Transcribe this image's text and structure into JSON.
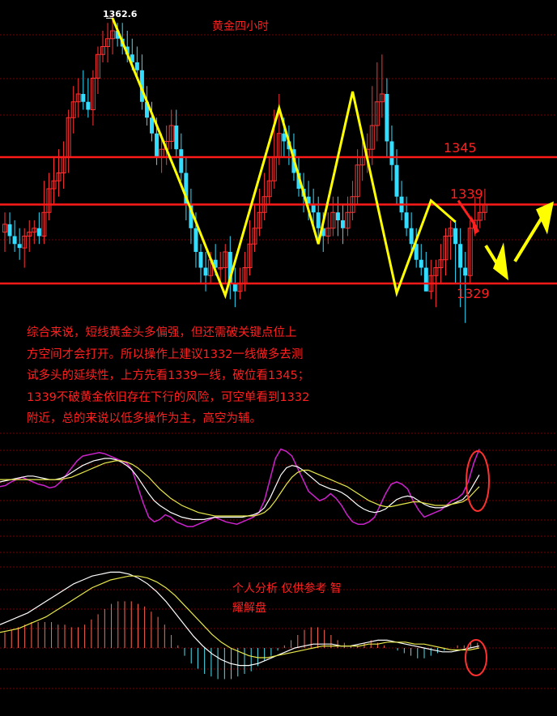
{
  "title": "黄金四小时",
  "peak_label": "1362.6",
  "levels": [
    {
      "value": 1345,
      "label": "1345"
    },
    {
      "value": 1339,
      "label": "1339"
    },
    {
      "value": 1329,
      "label": "1329"
    }
  ],
  "analysis_lines": [
    "综合来说，短线黄金头多偏强，但还需破关键点位上",
    "方空间才会打开。所以操作上建议1332一线做多去测",
    "试多头的延续性，上方先看1339一线，破位看1345；",
    "1339不破黄金依旧存在下行的风险，可空单看到1332",
    "附近，总的来说以低多操作为主，高空为辅。"
  ],
  "disclaimer_line1": "个人分析 仅供参考  智",
  "disclaimer_line2": "耀解盘",
  "colors": {
    "background": "#000000",
    "level_line": "#ff1a1a",
    "grid": "#7a0000",
    "bull_candle": "#ff3333",
    "bear_candle": "#33ddff",
    "zigzag": "#ffff00",
    "annotation_text": "#ff2020",
    "indicator_magenta": "#cc22cc",
    "indicator_white": "#ffffff",
    "indicator_yellow": "#e8e84a"
  },
  "chart_data": {
    "type": "candlestick",
    "ylim": [
      1325,
      1364
    ],
    "x": [
      1,
      2,
      3,
      4,
      5,
      6,
      7,
      8,
      9,
      10,
      11,
      12,
      13,
      14,
      15,
      16,
      17,
      18,
      19,
      20,
      21,
      22,
      23,
      24,
      25,
      26,
      27,
      28,
      29,
      30,
      31,
      32,
      33,
      34,
      35,
      36,
      37,
      38,
      39,
      40,
      41,
      42,
      43,
      44,
      45,
      46,
      47,
      48,
      49,
      50,
      51,
      52,
      53,
      54,
      55,
      56,
      57,
      58,
      59,
      60,
      61,
      62,
      63,
      64,
      65,
      66,
      67,
      68,
      69,
      70,
      71,
      72,
      73,
      74,
      75,
      76,
      77,
      78,
      79,
      80,
      81,
      82,
      83,
      84,
      85,
      86,
      87,
      88,
      89,
      90,
      91,
      92,
      93,
      94,
      95,
      96,
      97,
      98,
      99,
      100
    ],
    "open": [
      1335.5,
      1336.5,
      1335,
      1334,
      1333.5,
      1335,
      1335.5,
      1336,
      1335,
      1338,
      1341,
      1342,
      1343,
      1345,
      1350,
      1352,
      1353,
      1352,
      1351,
      1355,
      1358,
      1359,
      1360,
      1361,
      1360,
      1359,
      1358,
      1357,
      1356,
      1352,
      1350,
      1348,
      1345,
      1346,
      1347,
      1349,
      1346,
      1343,
      1339,
      1336,
      1333,
      1331,
      1330,
      1332,
      1331,
      1331,
      1333,
      1329,
      1328,
      1329,
      1331,
      1334,
      1336,
      1338,
      1340,
      1342,
      1345,
      1348,
      1347,
      1346,
      1343,
      1341,
      1340,
      1339,
      1338,
      1336,
      1335,
      1336,
      1338,
      1337,
      1336,
      1338,
      1340,
      1344,
      1345,
      1346,
      1349,
      1352,
      1353,
      1347,
      1344,
      1340,
      1338,
      1336,
      1334,
      1332,
      1331,
      1328,
      1330,
      1331,
      1332,
      1335,
      1336,
      1334,
      1331,
      1330,
      1336,
      1337,
      1338,
      1339
    ],
    "high": [
      1338,
      1338,
      1337,
      1336,
      1336,
      1337,
      1337,
      1338,
      1342,
      1343,
      1345,
      1346,
      1347,
      1351,
      1354,
      1355,
      1356,
      1355,
      1356,
      1359,
      1361,
      1362,
      1363,
      1362,
      1362,
      1361,
      1360,
      1359,
      1358,
      1354,
      1352,
      1350,
      1348,
      1349,
      1351,
      1351,
      1348,
      1345,
      1341,
      1338,
      1334,
      1333,
      1333,
      1334,
      1333,
      1334,
      1335,
      1331,
      1331,
      1333,
      1337,
      1339,
      1341,
      1343,
      1345,
      1351,
      1353,
      1350,
      1349,
      1348,
      1345,
      1343,
      1342,
      1341,
      1340,
      1338,
      1338,
      1340,
      1340,
      1339,
      1340,
      1342,
      1346,
      1347,
      1348,
      1354,
      1357,
      1358,
      1355,
      1349,
      1346,
      1342,
      1340,
      1338,
      1336,
      1334,
      1333,
      1332,
      1332,
      1334,
      1336,
      1337,
      1337,
      1336,
      1333,
      1337,
      1340,
      1340,
      1341,
      1340
    ],
    "low": [
      1333,
      1334,
      1333,
      1332,
      1331,
      1333,
      1334,
      1334,
      1334,
      1337,
      1339,
      1340,
      1341,
      1343,
      1348,
      1350,
      1351,
      1350,
      1349,
      1353,
      1357,
      1357,
      1358,
      1359,
      1358,
      1357,
      1356,
      1355,
      1351,
      1349,
      1347,
      1344,
      1343,
      1344,
      1346,
      1345,
      1342,
      1337,
      1334,
      1331,
      1329,
      1328,
      1329,
      1330,
      1329,
      1329,
      1327,
      1326,
      1327,
      1328,
      1330,
      1333,
      1335,
      1337,
      1339,
      1341,
      1344,
      1345,
      1344,
      1342,
      1340,
      1338,
      1337,
      1336,
      1334,
      1333,
      1334,
      1335,
      1335,
      1334,
      1335,
      1337,
      1339,
      1342,
      1343,
      1344,
      1347,
      1350,
      1345,
      1342,
      1339,
      1337,
      1335,
      1333,
      1331,
      1330,
      1328,
      1327,
      1326,
      1329,
      1330,
      1332,
      1329,
      1326,
      1324,
      1329,
      1335,
      1336,
      1337,
      1337
    ],
    "close": [
      1336.5,
      1335,
      1334,
      1333.5,
      1335,
      1335.5,
      1336,
      1335,
      1338,
      1341,
      1342,
      1343,
      1345,
      1350,
      1352,
      1353,
      1352,
      1351,
      1355,
      1358,
      1359,
      1360,
      1361,
      1360,
      1359,
      1358,
      1357,
      1356,
      1352,
      1350,
      1348,
      1345,
      1346,
      1347,
      1349,
      1346,
      1343,
      1339,
      1336,
      1333,
      1331,
      1330,
      1332,
      1331,
      1331,
      1333,
      1329,
      1328,
      1329,
      1331,
      1334,
      1336,
      1338,
      1340,
      1342,
      1345,
      1348,
      1347,
      1346,
      1343,
      1341,
      1340,
      1339,
      1338,
      1336,
      1335,
      1336,
      1338,
      1337,
      1336,
      1338,
      1340,
      1344,
      1345,
      1346,
      1349,
      1352,
      1353,
      1347,
      1344,
      1340,
      1338,
      1336,
      1334,
      1332,
      1331,
      1328,
      1330,
      1331,
      1332,
      1335,
      1336,
      1334,
      1331,
      1330,
      1336,
      1337,
      1338,
      1339,
      1338.5
    ],
    "zigzag": [
      [
        23,
        1362.6
      ],
      [
        37,
        1334
      ],
      [
        45,
        1327.5
      ],
      [
        57,
        1351
      ],
      [
        65,
        1333.5
      ],
      [
        72,
        1353.5
      ],
      [
        80,
        1336
      ],
      [
        82,
        1328
      ],
      [
        85,
        1333
      ],
      [
        93,
        1339.5
      ],
      [
        99,
        1336.5
      ]
    ],
    "zigzag_anchor": [
      [
        23,
        1362.6
      ],
      [
        36,
        1343
      ],
      [
        46,
        1327.5
      ],
      [
        57,
        1351.2
      ],
      [
        65,
        1334
      ],
      [
        72,
        1353.3
      ],
      [
        81,
        1327.8
      ],
      [
        88,
        1339.5
      ],
      [
        93,
        1336.8
      ]
    ],
    "projection": [
      [
        95,
        1334.5
      ],
      [
        99,
        1330.5
      ],
      [
        107,
        1338
      ]
    ],
    "hlines": [
      1345,
      1339,
      1329
    ],
    "indicator1": {
      "magenta": [
        56,
        57,
        60,
        62,
        64,
        62,
        60,
        58,
        57,
        55,
        56,
        60,
        66,
        72,
        78,
        82,
        83,
        84,
        85,
        84,
        82,
        80,
        78,
        76,
        70,
        56,
        42,
        30,
        26,
        28,
        32,
        30,
        26,
        24,
        22,
        22,
        24,
        26,
        28,
        30,
        28,
        26,
        25,
        24,
        26,
        28,
        30,
        34,
        44,
        62,
        80,
        88,
        86,
        82,
        72,
        62,
        52,
        48,
        44,
        46,
        50,
        46,
        40,
        32,
        26,
        24,
        24,
        26,
        30,
        40,
        50,
        58,
        60,
        58,
        54,
        44,
        36,
        30,
        32,
        34,
        36,
        40,
        44,
        46,
        50,
        60,
        76,
        88
      ],
      "white": [
        60,
        61,
        62,
        63,
        64,
        65,
        65,
        64,
        63,
        62,
        62,
        63,
        65,
        68,
        71,
        74,
        76,
        78,
        79,
        80,
        80,
        79,
        77,
        74,
        70,
        64,
        57,
        50,
        44,
        40,
        37,
        34,
        32,
        30,
        29,
        28,
        28,
        28,
        29,
        30,
        30,
        30,
        30,
        30,
        30,
        31,
        32,
        34,
        38,
        46,
        56,
        66,
        72,
        74,
        73,
        70,
        66,
        62,
        58,
        56,
        54,
        53,
        51,
        48,
        44,
        40,
        37,
        35,
        34,
        35,
        37,
        41,
        45,
        47,
        48,
        47,
        44,
        41,
        39,
        38,
        38,
        39,
        41,
        43,
        45,
        50,
        58,
        66
      ],
      "yellow": [
        62,
        62,
        62,
        62,
        62,
        62,
        62,
        62,
        62,
        62,
        62,
        62,
        63,
        64,
        66,
        68,
        70,
        72,
        74,
        76,
        77,
        78,
        78,
        77,
        75,
        72,
        68,
        64,
        59,
        54,
        50,
        46,
        43,
        40,
        38,
        36,
        34,
        33,
        32,
        31,
        31,
        31,
        31,
        31,
        31,
        31,
        31,
        32,
        34,
        38,
        44,
        51,
        58,
        64,
        68,
        70,
        70,
        68,
        66,
        64,
        62,
        60,
        58,
        56,
        53,
        50,
        47,
        44,
        42,
        40,
        39,
        39,
        40,
        41,
        42,
        43,
        43,
        42,
        41,
        40,
        40,
        40,
        41,
        42,
        43,
        46,
        51,
        56
      ]
    },
    "indicator2": {
      "macd_bars": [
        6,
        7,
        8,
        9,
        10,
        10,
        10,
        10,
        9,
        9,
        8,
        8,
        9,
        11,
        13,
        15,
        17,
        18,
        18,
        18,
        17,
        16,
        14,
        12,
        9,
        5,
        1,
        -3,
        -6,
        -8,
        -10,
        -11,
        -12,
        -12,
        -12,
        -11,
        -10,
        -9,
        -7,
        -5,
        -3,
        -1,
        1,
        3,
        5,
        7,
        8,
        8,
        7,
        5,
        3,
        2,
        1,
        1,
        2,
        3,
        2,
        1,
        0,
        -1,
        -2,
        -3,
        -4,
        -4,
        -3,
        -2,
        -1,
        0,
        1,
        1,
        2,
        2
      ],
      "white": [
        12,
        14,
        16,
        18,
        21,
        24,
        27,
        30,
        33,
        35,
        37,
        38,
        39,
        39,
        38,
        36,
        33,
        29,
        24,
        18,
        12,
        6,
        1,
        -3,
        -6,
        -8,
        -9,
        -9,
        -8,
        -6,
        -4,
        -2,
        0,
        1,
        2,
        2,
        2,
        1,
        1,
        2,
        3,
        4,
        4,
        3,
        2,
        1,
        0,
        -1,
        -2,
        -2,
        -1,
        0,
        1
      ],
      "yellow": [
        8,
        9,
        10,
        12,
        14,
        16,
        19,
        22,
        25,
        28,
        31,
        33,
        35,
        36,
        37,
        37,
        36,
        34,
        31,
        27,
        22,
        17,
        12,
        7,
        3,
        0,
        -2,
        -4,
        -5,
        -5,
        -4,
        -3,
        -2,
        -1,
        0,
        1,
        1,
        1,
        1,
        1,
        2,
        2,
        3,
        3,
        3,
        2,
        2,
        1,
        0,
        -1,
        -1,
        -1,
        0
      ]
    }
  }
}
